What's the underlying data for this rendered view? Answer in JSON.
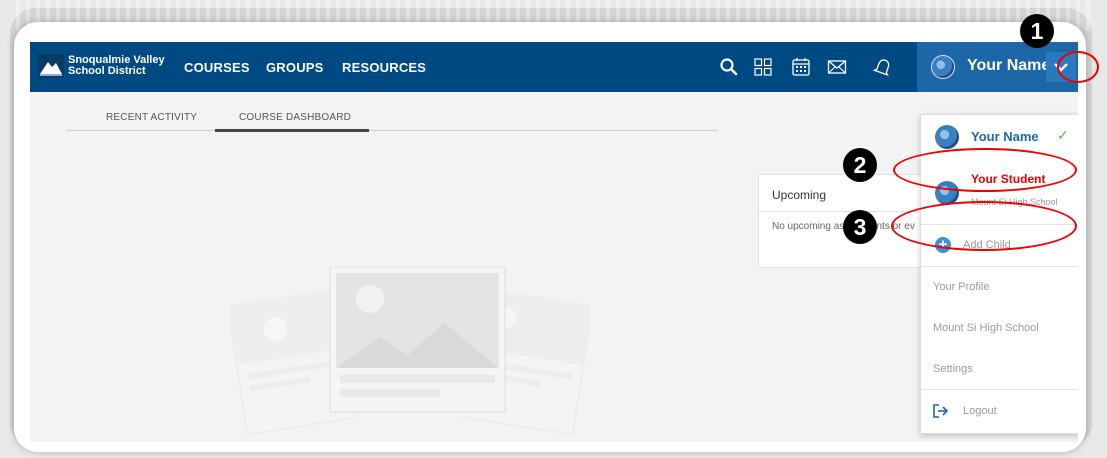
{
  "header": {
    "district_line1": "Snoqualmie Valley",
    "district_line2": "School District",
    "nav_links": [
      "COURSES",
      "GROUPS",
      "RESOURCES"
    ],
    "icons": [
      "search-icon",
      "apps-grid-icon",
      "calendar-icon",
      "mail-icon",
      "bell-icon"
    ],
    "user_name": "Your Name",
    "brand_color": "#004a83"
  },
  "tabs": [
    {
      "label": "RECENT ACTIVITY",
      "active": false
    },
    {
      "label": "COURSE DASHBOARD",
      "active": true
    }
  ],
  "upcoming": {
    "title": "Upcoming",
    "empty_text": "No upcoming assignments or ev"
  },
  "dropdown": {
    "current_user": "Your Name",
    "student_name": "Your Student",
    "student_school": "Mount Si High School",
    "add_child": "Add Child",
    "your_profile": "Your Profile",
    "school": "Mount Si High School",
    "settings": "Settings",
    "logout": "Logout"
  },
  "annotations": [
    "1",
    "2",
    "3"
  ],
  "annotation_color": "#e00000"
}
